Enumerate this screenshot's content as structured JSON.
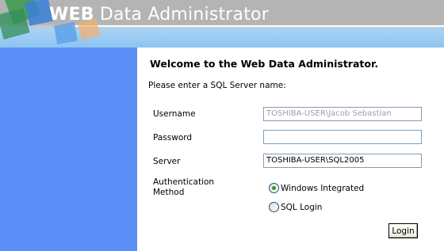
{
  "header": {
    "title_bold": "WEB",
    "title_rest": " Data Administrator"
  },
  "colors": {
    "sidebar": "#5b8ef6",
    "header_gray": "#b4b4b4",
    "header_blue": "#8dc4f0",
    "logo_green": "#3a9a4a",
    "logo_blue": "#3a80d8",
    "logo_orange": "#f0b070"
  },
  "form": {
    "welcome": "Welcome to the Web Data Administrator.",
    "prompt": "Please enter a SQL Server name:",
    "username_label": "Username",
    "username_value": "TOSHIBA-USER\\Jacob Sebastian",
    "password_label": "Password",
    "password_value": "",
    "server_label": "Server",
    "server_value": "TOSHIBA-USER\\SQL2005",
    "auth_label_line1": "Authentication",
    "auth_label_line2": "Method",
    "auth_options": [
      {
        "label": "Windows Integrated",
        "selected": true
      },
      {
        "label": "SQL Login",
        "selected": false
      }
    ],
    "login_label": "Login"
  }
}
